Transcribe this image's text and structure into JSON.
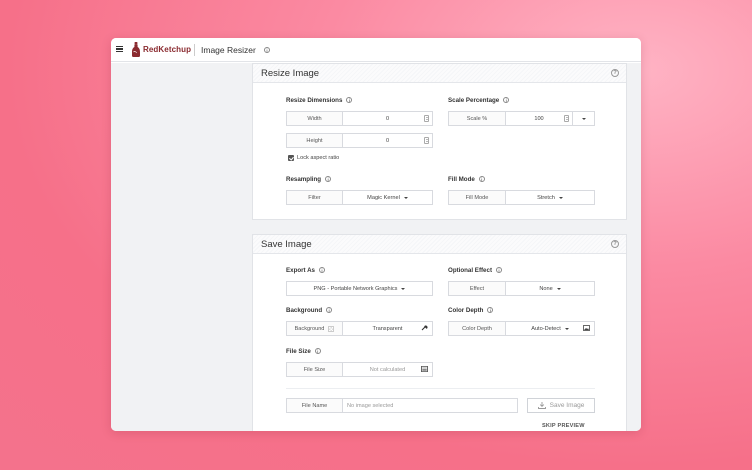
{
  "app": {
    "brand": "RedKetchup",
    "title": "Image Resizer"
  },
  "resize": {
    "section_title": "Resize Image",
    "dimensions_label": "Resize Dimensions",
    "width_label": "Width",
    "width_value": "0",
    "height_label": "Height",
    "height_value": "0",
    "lock_aspect_label": "Lock aspect ratio",
    "lock_aspect_checked": true,
    "scale_label": "Scale Percentage",
    "scale_addon": "Scale %",
    "scale_value": "100",
    "resampling_label": "Resampling",
    "filter_addon": "Filter",
    "filter_value": "Magic Kernel",
    "fill_mode_label": "Fill Mode",
    "fill_mode_addon": "Fill Mode",
    "fill_mode_value": "Stretch"
  },
  "save": {
    "section_title": "Save Image",
    "export_label": "Export As",
    "export_value": "PNG - Portable Network Graphics",
    "effect_label": "Optional Effect",
    "effect_addon": "Effect",
    "effect_value": "None",
    "background_label": "Background",
    "background_addon": "Background",
    "background_value": "Transparent",
    "color_depth_label": "Color Depth",
    "color_depth_addon": "Color Depth",
    "color_depth_value": "Auto-Detect",
    "file_size_label": "File Size",
    "file_size_addon": "File Size",
    "file_size_value": "Not calculated",
    "file_name_addon": "File Name",
    "file_name_value": "No image selected",
    "save_button": "Save Image",
    "skip_preview": "SKIP PREVIEW"
  },
  "colors": {
    "brand": "#8a2a2f",
    "background_gradient": [
      "#ffb3c4",
      "#f4728c"
    ]
  }
}
